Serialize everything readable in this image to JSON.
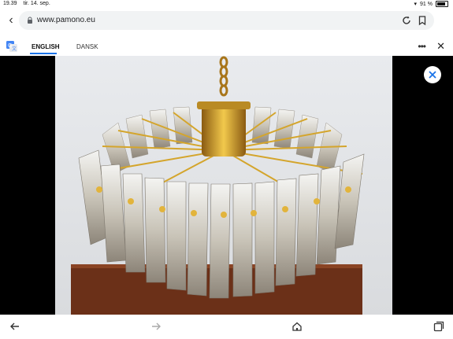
{
  "status_bar": {
    "time": "19.39",
    "date": "tir. 14. sep.",
    "battery_percent": "91 %"
  },
  "browser": {
    "url": "www.pamono.eu"
  },
  "translate": {
    "tab_english": "ENGLISH",
    "tab_dansk": "DANSK"
  },
  "icons": {
    "back": "chevron-left-icon",
    "lock": "lock-icon",
    "reload": "reload-icon",
    "bookmark": "bookmark-icon",
    "translate": "google-translate-icon",
    "more": "more-dots-icon",
    "close": "close-icon",
    "nav_back": "arrow-left-icon",
    "nav_forward": "arrow-right-icon",
    "home": "home-icon",
    "tabs": "tabs-icon"
  },
  "colors": {
    "accent": "#1a73e8",
    "viewer_bg": "#000000"
  }
}
